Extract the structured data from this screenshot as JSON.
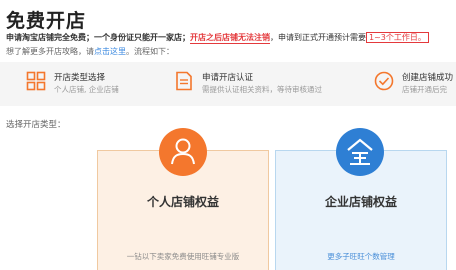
{
  "page": {
    "title": "免费开店"
  },
  "notice": {
    "part1": "申请淘宝店铺完全免费；一个身份证只能开一家店；",
    "part2": "开店之后店铺无法注销",
    "part3": "，申请到正式开通预计需要",
    "part4": "1~3个工作日。"
  },
  "more": {
    "prefix": "想了解更多开店攻略，请",
    "link": "点击这里",
    "suffix": "。流程如下："
  },
  "steps": [
    {
      "title": "开店类型选择",
      "desc": "个人店铺, 企业店铺",
      "icon": "grid-icon"
    },
    {
      "title": "申请开店认证",
      "desc": "需提供认证相关资料，等待审核通过",
      "icon": "document-icon"
    },
    {
      "title": "创建店铺成功",
      "desc": "店铺开通后完",
      "icon": "check-circle-icon"
    }
  ],
  "choose_label": "选择开店类型：",
  "cards": [
    {
      "title": "个人店铺权益",
      "desc": "一钻以下卖家免费使用旺铺专业版",
      "icon": "person-icon"
    },
    {
      "title": "企业店铺权益",
      "desc": "更多子旺旺个数管理",
      "icon": "enterprise-icon"
    }
  ],
  "colors": {
    "accent_red": "#e4393c",
    "orange": "#f4772d",
    "blue": "#2e7fd4"
  }
}
